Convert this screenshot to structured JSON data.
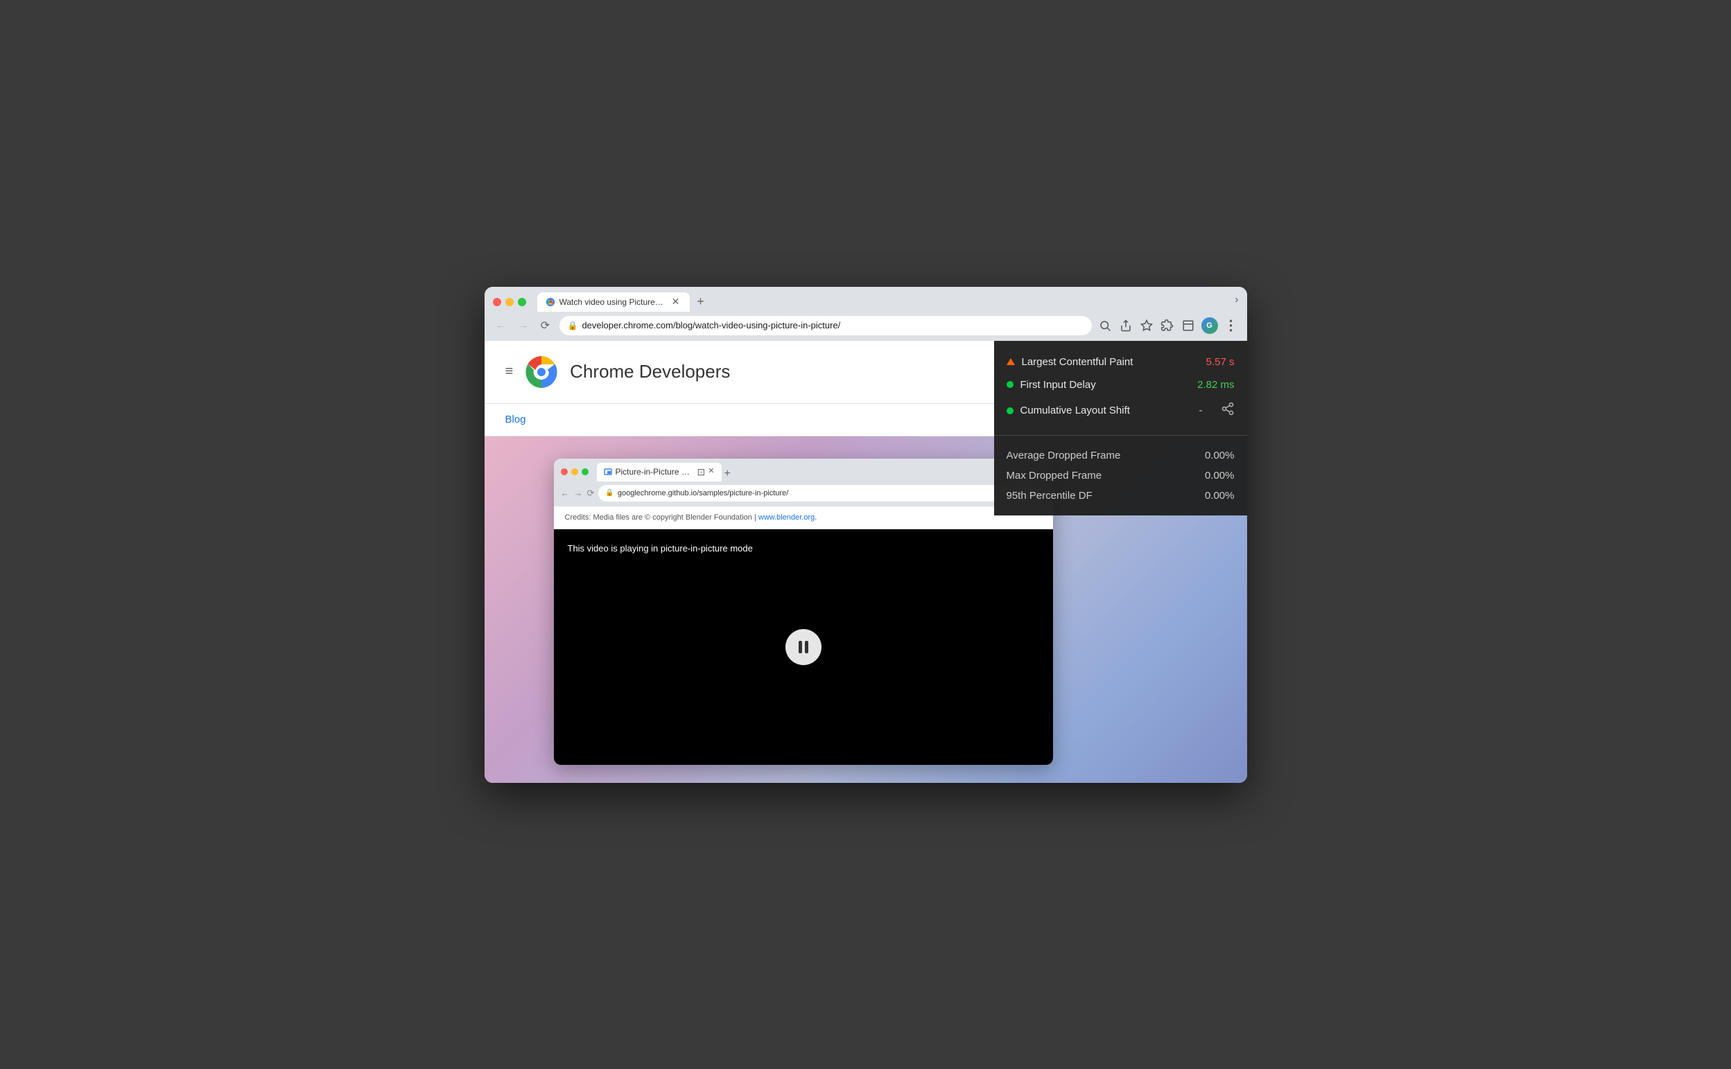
{
  "window": {
    "traffic_lights": [
      "red",
      "yellow",
      "green"
    ],
    "tab": {
      "title": "Watch video using Picture-in-P",
      "favicon": "chrome"
    },
    "new_tab_label": "+",
    "chevron": "›"
  },
  "address_bar": {
    "url": "developer.chrome.com/blog/watch-video-using-picture-in-picture/",
    "lock_icon": "🔒"
  },
  "toolbar": {
    "search_icon": "🔍",
    "share_icon": "⬆",
    "bookmark_icon": "☆",
    "extension_icon": "🧩",
    "window_icon": "⬜",
    "profile_initials": "G",
    "menu_icon": "⋮"
  },
  "chrome_dev_page": {
    "site_title": "Chrome Developers",
    "blog_link": "Blog",
    "hamburger": "≡"
  },
  "inner_browser": {
    "tab_title": "Picture-in-Picture Sample",
    "url": "googlechrome.github.io/samples/picture-in-picture/",
    "credits_text": "Credits: Media files are © copyright Blender Foundation | ",
    "credits_link": "www.blender.org",
    "video_text": "This video is playing in picture-in-picture mode"
  },
  "perf_overlay": {
    "metrics": [
      {
        "label": "Largest Contentful Paint",
        "value": "5.57 s",
        "value_color": "red",
        "indicator": "triangle"
      },
      {
        "label": "First Input Delay",
        "value": "2.82 ms",
        "value_color": "green",
        "indicator": "green"
      },
      {
        "label": "Cumulative Layout Shift",
        "value": "-",
        "value_color": "plain",
        "indicator": "green"
      }
    ],
    "frame_metrics": [
      {
        "label": "Average Dropped Frame",
        "value": "0.00%"
      },
      {
        "label": "Max Dropped Frame",
        "value": "0.00%"
      },
      {
        "label": "95th Percentile DF",
        "value": "0.00%"
      }
    ]
  }
}
